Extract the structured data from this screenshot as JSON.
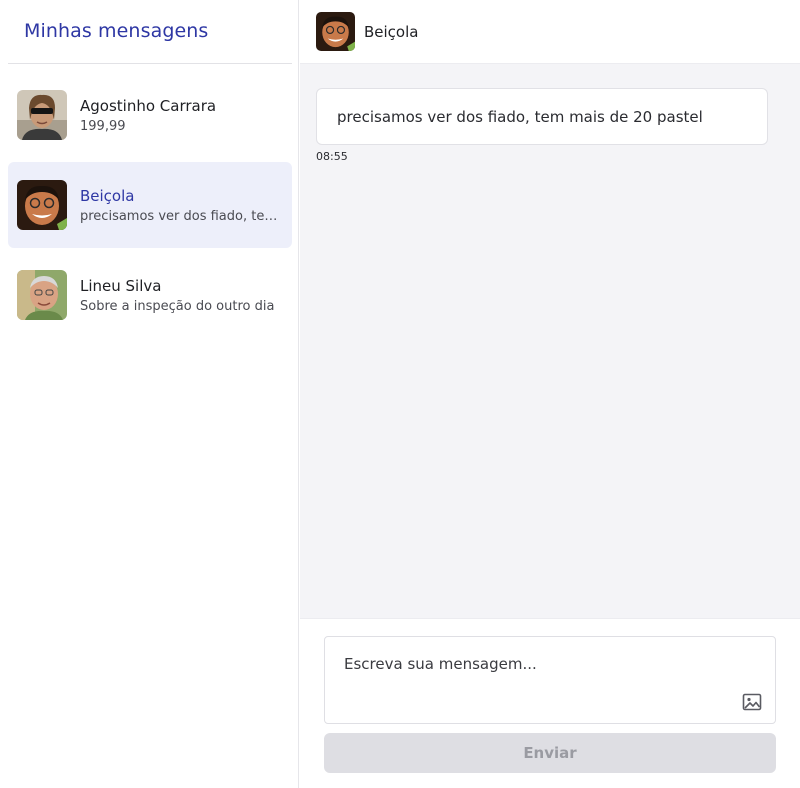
{
  "sidebar": {
    "title": "Minhas mensagens",
    "conversations": [
      {
        "name": "Agostinho Carrara",
        "preview": "199,99",
        "avatar": "avatar-agostinho",
        "active": false
      },
      {
        "name": "Beiçola",
        "preview": "precisamos ver dos fiado, tem mais de 20 pastel",
        "avatar": "avatar-beicola",
        "active": true
      },
      {
        "name": "Lineu Silva",
        "preview": "Sobre a inspeção do outro dia",
        "avatar": "avatar-lineu",
        "active": false
      }
    ]
  },
  "chat": {
    "contact_name": "Beiçola",
    "messages": [
      {
        "text": "precisamos ver dos fiado, tem mais de 20 pastel",
        "time": "08:55"
      }
    ],
    "composer": {
      "placeholder": "Escreva sua mensagem...",
      "value": "",
      "attach_icon": "image-icon",
      "send_label": "Enviar",
      "send_enabled": false
    }
  },
  "colors": {
    "accent": "#2e37a4",
    "active_bg": "#edeffa",
    "chat_bg": "#f4f4f7",
    "send_disabled_bg": "#dedee3"
  }
}
